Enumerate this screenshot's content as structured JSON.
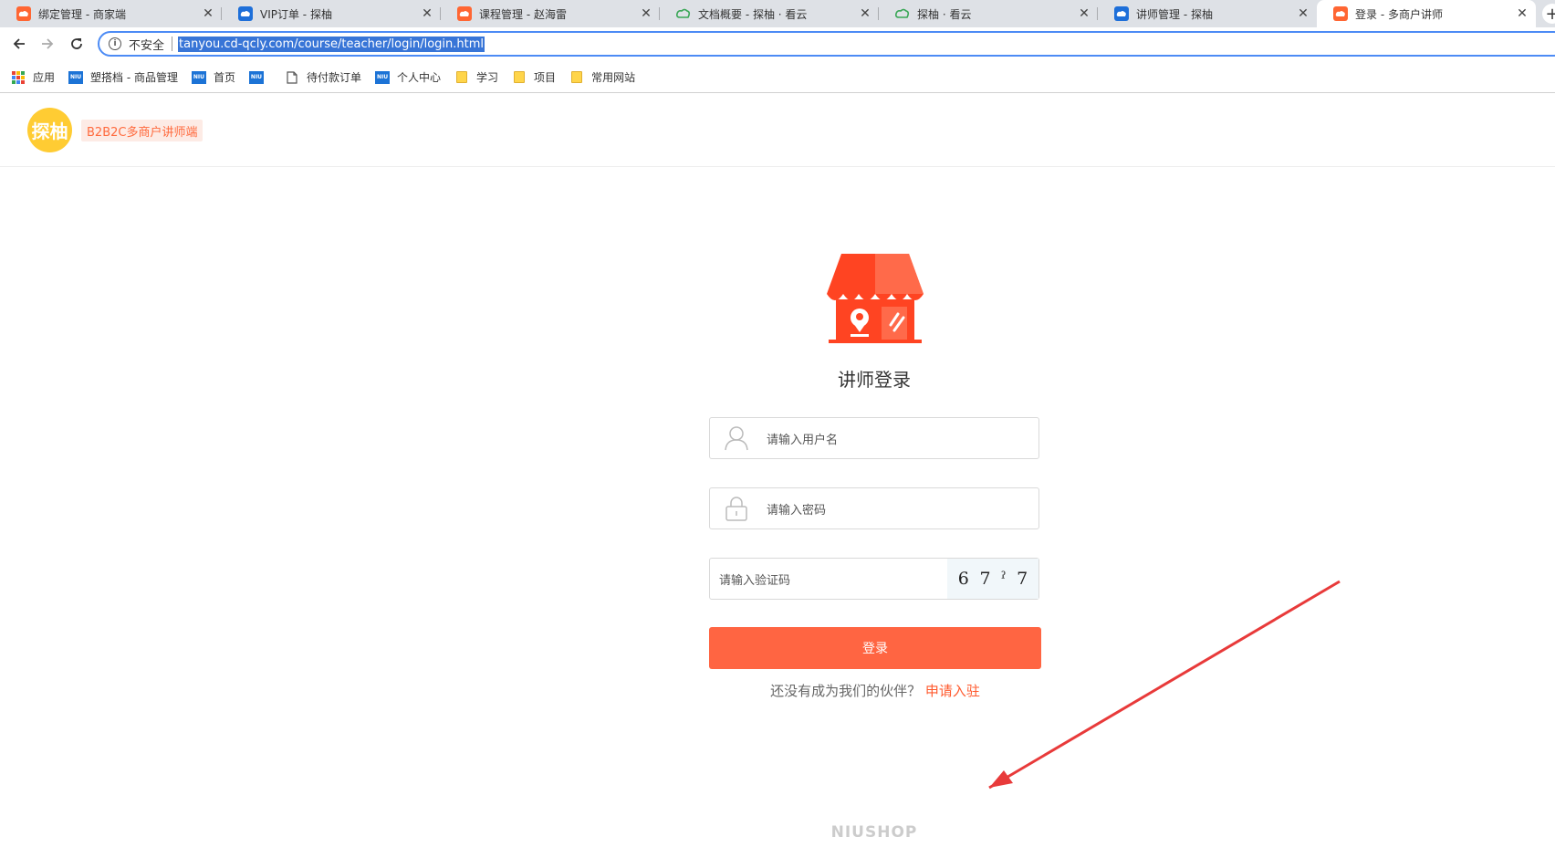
{
  "browser": {
    "tabs": [
      {
        "title": "绑定管理 - 商家端",
        "favicon": "orange-cloud-icon"
      },
      {
        "title": "VIP订单 - 探柚",
        "favicon": "blue-cloud-icon"
      },
      {
        "title": "课程管理 - 赵海雷",
        "favicon": "orange-cloud-icon"
      },
      {
        "title": "文档概要 - 探柚 · 看云",
        "favicon": "green-cloud-icon"
      },
      {
        "title": "探柚 · 看云",
        "favicon": "green-cloud-icon"
      },
      {
        "title": "讲师管理 - 探柚",
        "favicon": "blue-cloud-icon"
      },
      {
        "title": "登录 - 多商户讲师",
        "favicon": "orange-cloud-icon",
        "active": true
      }
    ],
    "security_label": "不安全",
    "url": "tanyou.cd-qcly.com/course/teacher/login/login.html",
    "bookmarks": [
      {
        "label": "应用",
        "icon": "apps-grid-icon"
      },
      {
        "label": "塑搭档 - 商品管理",
        "icon": "niu-icon"
      },
      {
        "label": "首页",
        "icon": "niu-icon"
      },
      {
        "label": "",
        "icon": "niu-icon"
      },
      {
        "label": "待付款订单",
        "icon": "page-icon"
      },
      {
        "label": "个人中心",
        "icon": "niu-icon"
      },
      {
        "label": "学习",
        "icon": "folder-icon"
      },
      {
        "label": "项目",
        "icon": "folder-icon"
      },
      {
        "label": "常用网站",
        "icon": "folder-icon"
      }
    ],
    "niu_text": "NIU"
  },
  "header": {
    "logo_text": "探柚",
    "tagline": "B2B2C多商户讲师端"
  },
  "login": {
    "title": "讲师登录",
    "username_placeholder": "请输入用户名",
    "password_placeholder": "请输入密码",
    "captcha_placeholder": "请输入验证码",
    "captcha_chars": [
      "6",
      "7",
      "ˀ",
      "7"
    ],
    "submit_label": "登录",
    "apply_prompt": "还没有成为我们的伙伴？",
    "apply_link": "申请入驻"
  },
  "footer": {
    "brand": "NIUSHOP"
  },
  "colors": {
    "accent": "#ff6542",
    "logo_yellow": "#ffcc33",
    "annotation_arrow": "#e83a3a"
  }
}
